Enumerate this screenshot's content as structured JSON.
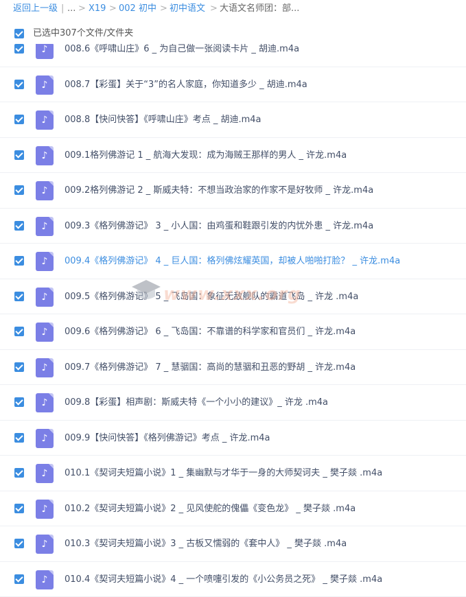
{
  "breadcrumb": {
    "back": "返回上一级",
    "ellipsis": "...",
    "items": [
      "X19",
      "002 初中",
      "初中语文"
    ],
    "current": "大语文名师团：部..."
  },
  "selection": {
    "label": "已选中307个文件/文件夹"
  },
  "watermark": "www.xxx.org",
  "files": [
    {
      "name": "008.6《呼啸山庄》6 _ 为自己做一张阅读卡片 _ 胡迪.m4a"
    },
    {
      "name": "008.7【彩蛋】关于“3”的名人家庭，你知道多少 _ 胡迪.m4a"
    },
    {
      "name": "008.8【快问快答】《呼啸山庄》考点 _ 胡迪.m4a"
    },
    {
      "name": "009.1格列佛游记 1 _ 航海大发现：成为海贼王那样的男人 _ 许龙.m4a"
    },
    {
      "name": "009.2格列佛游记 2 _ 斯威夫特：不想当政治家的作家不是好牧师 _ 许龙.m4a"
    },
    {
      "name": "009.3《格列佛游记》 3 _ 小人国：由鸡蛋和鞋跟引发的内忧外患 _ 许龙.m4a"
    },
    {
      "name": "009.4《格列佛游记》 4 _ 巨人国：格列佛炫耀英国，却被人啪啪打脸？ _ 许龙.m4a",
      "active": true
    },
    {
      "name": "009.5《格列佛游记》 5 _ 飞岛国：象征无敌舰队的霸道飞岛 _ 许龙 .m4a"
    },
    {
      "name": "009.6《格列佛游记》 6 _ 飞岛国：不靠谱的科学家和官员们 _ 许龙.m4a"
    },
    {
      "name": "009.7《格列佛游记》 7 _ 慧骃国：高尚的慧骃和丑恶的野胡 _ 许龙.m4a"
    },
    {
      "name": "009.8【彩蛋】相声剧：斯威夫特《一个小小的建议》_ 许龙 .m4a"
    },
    {
      "name": "009.9【快问快答】《格列佛游记》考点 _ 许龙.m4a"
    },
    {
      "name": "010.1《契诃夫短篇小说》1 _ 集幽默与才华于一身的大师契诃夫 _ 樊子燚 .m4a"
    },
    {
      "name": "010.2《契诃夫短篇小说》2 _ 见风使舵的傀儡《变色龙》 _ 樊子燚 .m4a"
    },
    {
      "name": "010.3《契诃夫短篇小说》3 _ 古板又懦弱的《套中人》 _ 樊子燚 .m4a"
    },
    {
      "name": "010.4《契诃夫短篇小说》4 _ 一个喷嚏引发的《小公务员之死》 _ 樊子燚 .m4a"
    }
  ],
  "icons": {
    "file": "music-note-icon",
    "check": "checkbox-checked-icon"
  },
  "colors": {
    "accent": "#3b8de0",
    "file_icon": "#7b7fe6"
  }
}
